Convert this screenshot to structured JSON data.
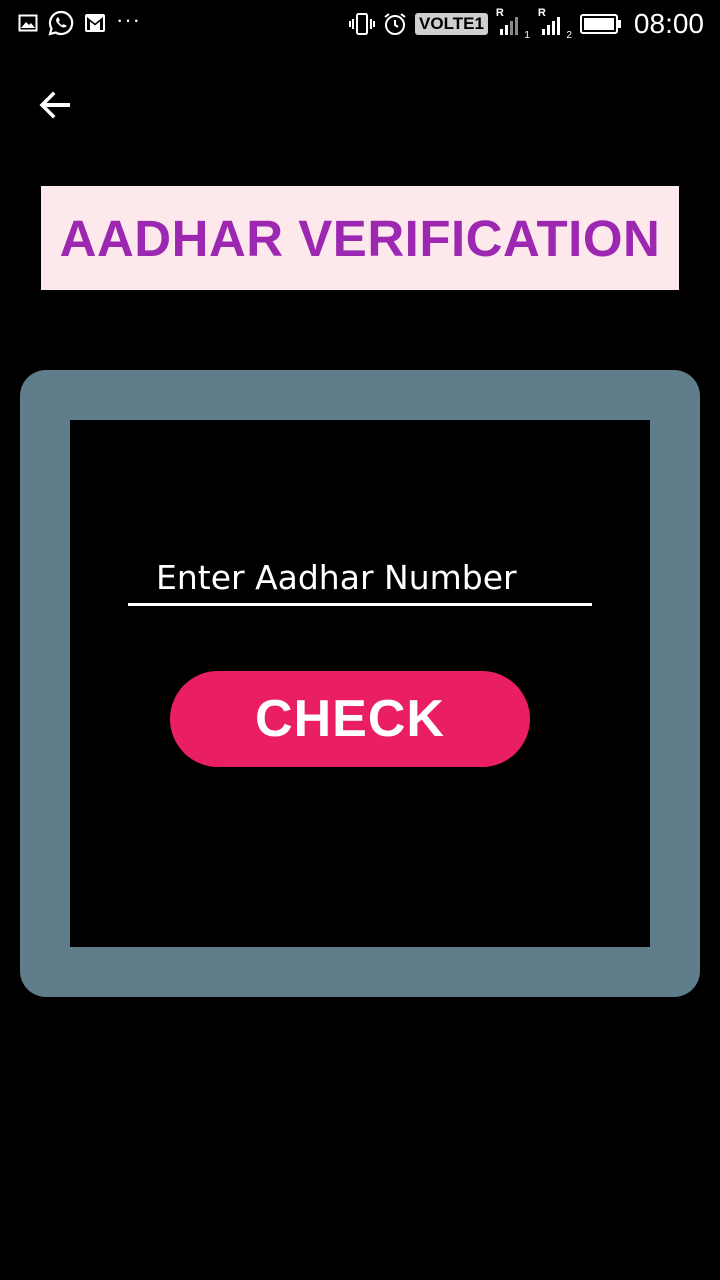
{
  "status_bar": {
    "left_icons": [
      "gallery-icon",
      "whatsapp-icon",
      "gmail-icon"
    ],
    "more": "···",
    "network_label": "VOLTE1",
    "sim1_roaming": "R",
    "sim1_index": "1",
    "sim2_roaming": "R",
    "sim2_index": "2",
    "time": "08:00"
  },
  "header": {
    "back_icon": "arrow-back-icon",
    "title": "AADHAR VERIFICATION",
    "title_color": "#9c27b0",
    "title_bg": "#fde8ec"
  },
  "form": {
    "frame_color": "#607d8b",
    "input_placeholder": "Enter Aadhar Number",
    "input_value": "",
    "button_label": "CHECK",
    "button_color": "#e91e63"
  }
}
